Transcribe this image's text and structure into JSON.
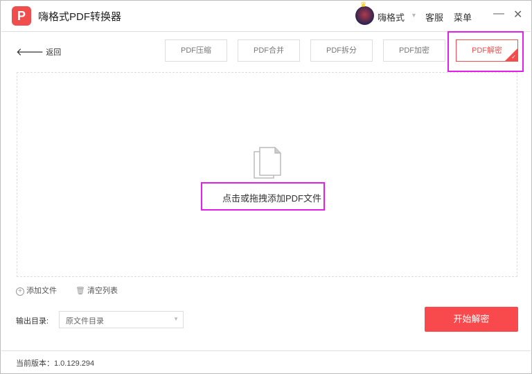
{
  "app": {
    "logo": "P",
    "title": "嗨格式PDF转换器"
  },
  "header": {
    "username": "嗨格式",
    "service": "客服",
    "menu": "菜单",
    "minimize": "—",
    "close": "✕"
  },
  "nav": {
    "back": "返回",
    "tabs": [
      {
        "label": "PDF压缩"
      },
      {
        "label": "PDF合并"
      },
      {
        "label": "PDF拆分"
      },
      {
        "label": "PDF加密"
      },
      {
        "label": "PDF解密",
        "active": true
      }
    ]
  },
  "drop": {
    "text": "点击或拖拽添加PDF文件"
  },
  "actions": {
    "add": "添加文件",
    "clear": "清空列表"
  },
  "output": {
    "label": "输出目录:",
    "value": "原文件目录"
  },
  "start_button": "开始解密",
  "footer": {
    "version": "当前版本：1.0.129.294"
  },
  "colors": {
    "accent": "#f84a4d",
    "highlight": "#e31ee8"
  }
}
